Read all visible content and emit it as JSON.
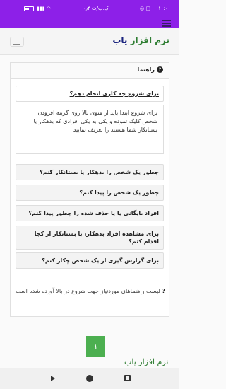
{
  "status_bar": {
    "time": "۱۰:۰۰",
    "rate": "۰٫۴ ک.ب/ث",
    "battery_icon": "battery-icon",
    "signal_icon": "signal-icon",
    "wifi_icon": "wifi-icon"
  },
  "app_bar": {
    "title_green": "نرم افزار",
    "title_blue": "یاب"
  },
  "help": {
    "title": "راهنما",
    "items": [
      {
        "label": "برای شروع چه کاری انجام دهم؟",
        "open": true,
        "answer": "برای شروع ابتدا باید از منوی بالا روی گزینه افزودن شخص کلیک نموده و یکی به یکی افرادی که بدهکار یا بستانکار شما هستند را تعریف نمایید"
      },
      {
        "label": "چطور یک شخص را بدهکار یا بستانکار کنم؟",
        "open": false
      },
      {
        "label": "چطور یک شخص را پیدا کنم؟",
        "open": false
      },
      {
        "label": "افراد بایگانی یا یا حذف شده را چطور پیدا کنم؟",
        "open": false
      },
      {
        "label": "برای مشاهده افراد بدهکار، یا بستانکار از کجا اقدام کنم؟",
        "open": false
      },
      {
        "label": "برای گزارش گیری از یک شخص چکار کنم؟",
        "open": false
      }
    ],
    "tip_mark": "?",
    "tip": "لیست راهنماهای موردنیاز جهت شروع در بالا آورده شده است"
  },
  "pagination": {
    "current": "۱"
  },
  "watermark": "نرم افزار یاب"
}
